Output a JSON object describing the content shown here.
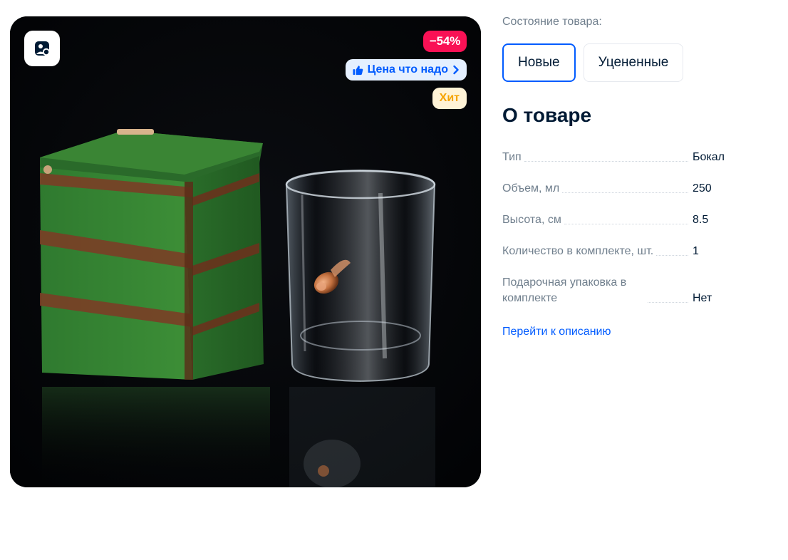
{
  "gallery": {
    "badges": {
      "discount": "−54%",
      "price_label": "Цена что надо",
      "hit": "Хит"
    },
    "icons": {
      "photo_search": "photo-search-icon",
      "thumbs_up": "thumbs-up-icon",
      "chevron": "chevron-right-icon"
    }
  },
  "condition": {
    "label": "Состояние товара:",
    "options": [
      "Новые",
      "Уцененные"
    ],
    "selected": "Новые"
  },
  "about": {
    "title": "О товаре",
    "specs": [
      {
        "name": "Тип",
        "value": "Бокал"
      },
      {
        "name": "Объем, мл",
        "value": "250"
      },
      {
        "name": "Высота, см",
        "value": "8.5"
      },
      {
        "name": "Количество в комплекте, шт.",
        "value": "1"
      },
      {
        "name": "Подарочная упаковка в комплекте",
        "value": "Нет"
      }
    ],
    "link": "Перейти к описанию"
  },
  "colors": {
    "accent": "#005bff",
    "discount": "#f91155",
    "hit": "#f5a300",
    "text": "#001a34",
    "muted": "#707f8d"
  }
}
